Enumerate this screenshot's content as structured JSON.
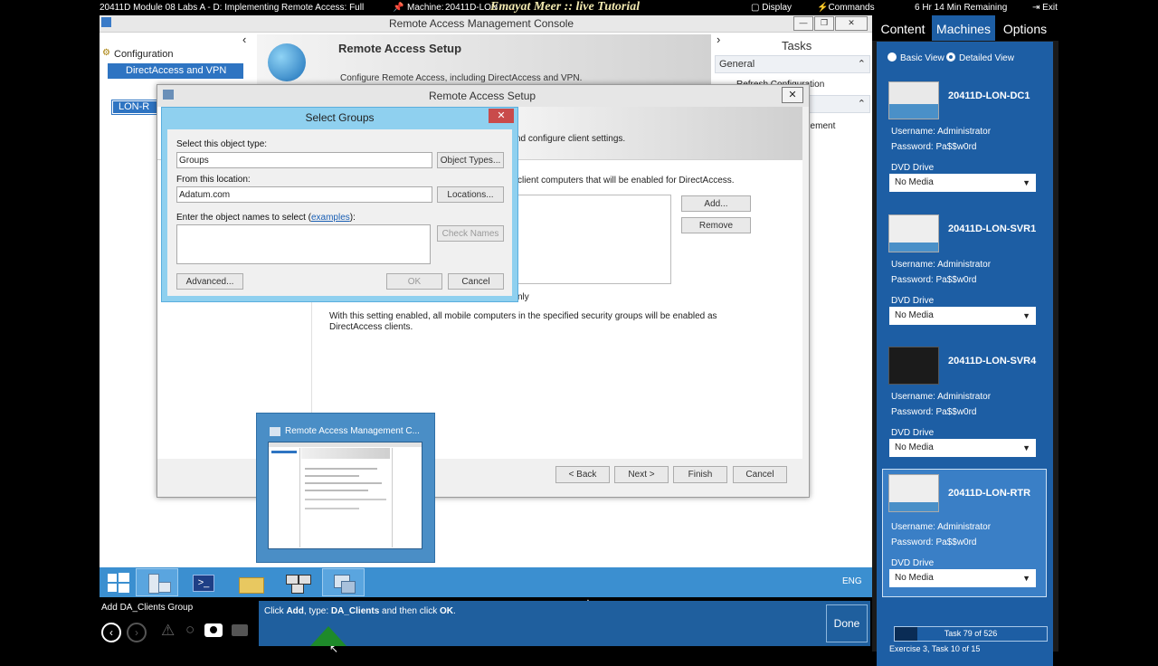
{
  "lab_bar": {
    "title": "20411D Module 08 Labs A - D: Implementing Remote Access: Full",
    "machine_label": "Machine:",
    "machine_value": "20411D-LON",
    "watermark": "Emayat Meer  ::  live Tutorial",
    "display": "Display",
    "commands": "Commands",
    "time_remaining": "6 Hr 14 Min Remaining",
    "exit": "Exit"
  },
  "console": {
    "title": "Remote Access Management Console",
    "nav": {
      "configuration": "Configuration",
      "directaccess": "DirectAccess and VPN",
      "server": "LON-R"
    },
    "setup_header": {
      "title": "Remote Access Setup",
      "subtitle": "Configure Remote Access, including DirectAccess and VPN."
    },
    "tasks": {
      "title": "Tasks",
      "general": "General",
      "item1": "Refresh Configuration",
      "item2": "gement"
    }
  },
  "setup_dialog": {
    "title": "Remote Access Setup",
    "header_text": "nd configure client settings.",
    "select_text": "client computers that will be enabled for DirectAccess.",
    "add": "Add...",
    "remove": "Remove",
    "only_text": "nly",
    "description": "With this setting enabled, all mobile computers in the specified security groups will be enabled as DirectAccess clients.",
    "back": "< Back",
    "next": "Next >",
    "finish": "Finish",
    "cancel": "Cancel"
  },
  "select_groups": {
    "title": "Select Groups",
    "object_type_label": "Select this object type:",
    "object_type_value": "Groups",
    "object_types_button": "Object Types...",
    "location_label": "From this location:",
    "location_value": "Adatum.com",
    "locations_button": "Locations...",
    "names_label_prefix": "Enter the object names to select (",
    "names_label_link": "examples",
    "names_label_suffix": "):",
    "names_value": "",
    "check_names": "Check Names",
    "advanced": "Advanced...",
    "ok": "OK",
    "cancel": "Cancel"
  },
  "taskbar_preview": {
    "title": "Remote Access Management C..."
  },
  "taskbar": {
    "language": "ENG"
  },
  "bottom": {
    "task_name": "Add DA_Clients Group",
    "instruction_prefix": "Click ",
    "instruction_b1": "Add",
    "instruction_mid": ", type: ",
    "instruction_b2": "DA_Clients",
    "instruction_mid2": " and then click ",
    "instruction_b3": "OK",
    "instruction_end": ".",
    "done": "Done"
  },
  "right_panel": {
    "tabs": [
      "Content",
      "Machines",
      "Options"
    ],
    "active_tab": "Machines",
    "view_basic": "Basic View",
    "view_detailed": "Detailed View",
    "machines": [
      {
        "name": "20411D-LON-DC1",
        "username": "Username: Administrator",
        "password": "Password:  Pa$$w0rd",
        "dvd_label": "DVD Drive",
        "dvd_value": "No Media"
      },
      {
        "name": "20411D-LON-SVR1",
        "username": "Username: Administrator",
        "password": "Password:  Pa$$w0rd",
        "dvd_label": "DVD Drive",
        "dvd_value": "No Media"
      },
      {
        "name": "20411D-LON-SVR4",
        "username": "Username: Administrator",
        "password": "Password:  Pa$$w0rd",
        "dvd_label": "DVD Drive",
        "dvd_value": "No Media"
      },
      {
        "name": "20411D-LON-RTR",
        "username": "Username: Administrator",
        "password": "Password:  Pa$$w0rd",
        "dvd_label": "DVD Drive",
        "dvd_value": "No Media"
      }
    ],
    "task_progress": "Task 79 of 526",
    "task_progress_fraction": 0.15,
    "exercise": "Exercise 3, Task 10 of 15"
  },
  "colors": {
    "accent_blue": "#1d5ea4",
    "taskbar_blue": "#3b8fd0",
    "select_groups_frame": "#8fd0ef",
    "close_red": "#c94b4b"
  }
}
